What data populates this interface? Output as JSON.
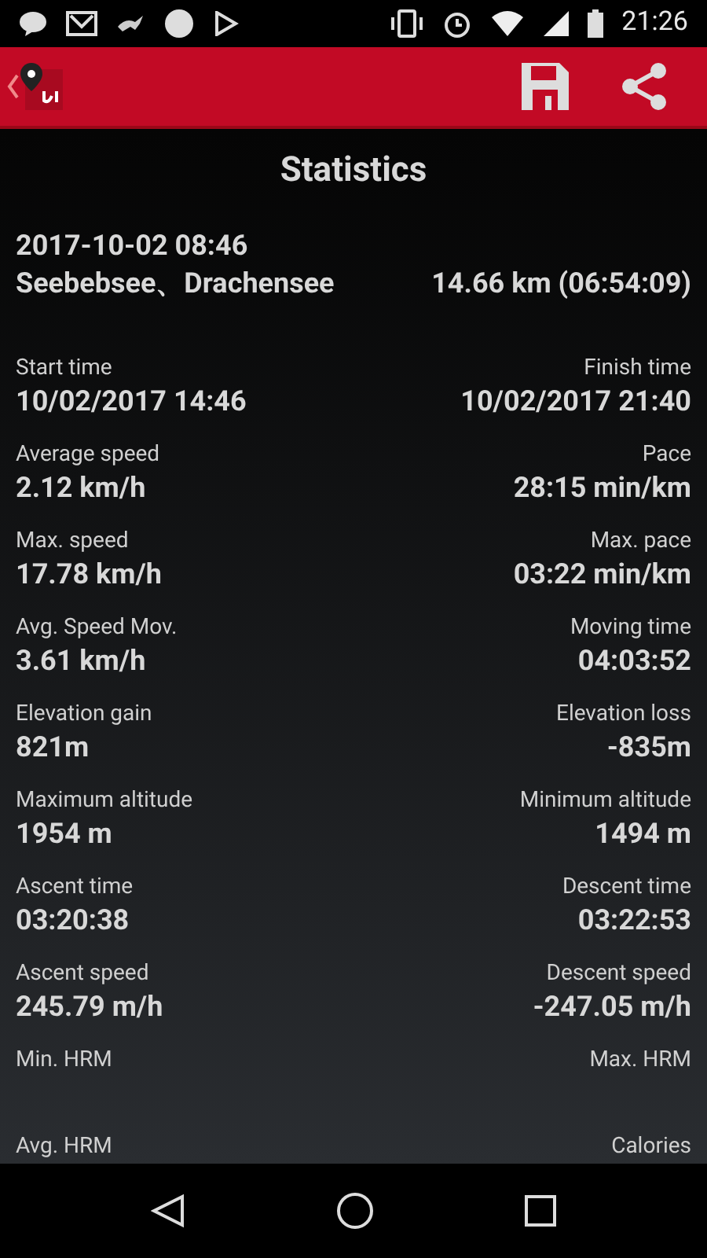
{
  "status_bar": {
    "time": "21:26"
  },
  "header": {
    "title": "Statistics"
  },
  "summary": {
    "date": "2017-10-02 08:46",
    "place": "Seebebsee、Drachensee",
    "distance": "14.66 km (06:54:09)"
  },
  "stats": [
    {
      "left": {
        "label": "Start time",
        "value": "10/02/2017 14:46"
      },
      "right": {
        "label": "Finish time",
        "value": "10/02/2017 21:40"
      }
    },
    {
      "left": {
        "label": "Average speed",
        "value": "2.12 km/h"
      },
      "right": {
        "label": "Pace",
        "value": "28:15 min/km"
      }
    },
    {
      "left": {
        "label": "Max. speed",
        "value": "17.78 km/h"
      },
      "right": {
        "label": "Max. pace",
        "value": "03:22 min/km"
      }
    },
    {
      "left": {
        "label": "Avg. Speed Mov.",
        "value": "3.61 km/h"
      },
      "right": {
        "label": "Moving time",
        "value": "04:03:52"
      }
    },
    {
      "left": {
        "label": "Elevation gain",
        "value": "821m"
      },
      "right": {
        "label": "Elevation loss",
        "value": "-835m"
      }
    },
    {
      "left": {
        "label": "Maximum altitude",
        "value": "1954 m"
      },
      "right": {
        "label": "Minimum altitude",
        "value": "1494 m"
      }
    },
    {
      "left": {
        "label": "Ascent time",
        "value": "03:20:38"
      },
      "right": {
        "label": "Descent time",
        "value": "03:22:53"
      }
    },
    {
      "left": {
        "label": "Ascent speed",
        "value": "245.79 m/h"
      },
      "right": {
        "label": "Descent speed",
        "value": "-247.05 m/h"
      }
    },
    {
      "left": {
        "label": "Min. HRM"
      },
      "right": {
        "label": "Max. HRM"
      }
    },
    {
      "left": {
        "label": "Avg. HRM"
      },
      "right": {
        "label": "Calories"
      }
    }
  ]
}
